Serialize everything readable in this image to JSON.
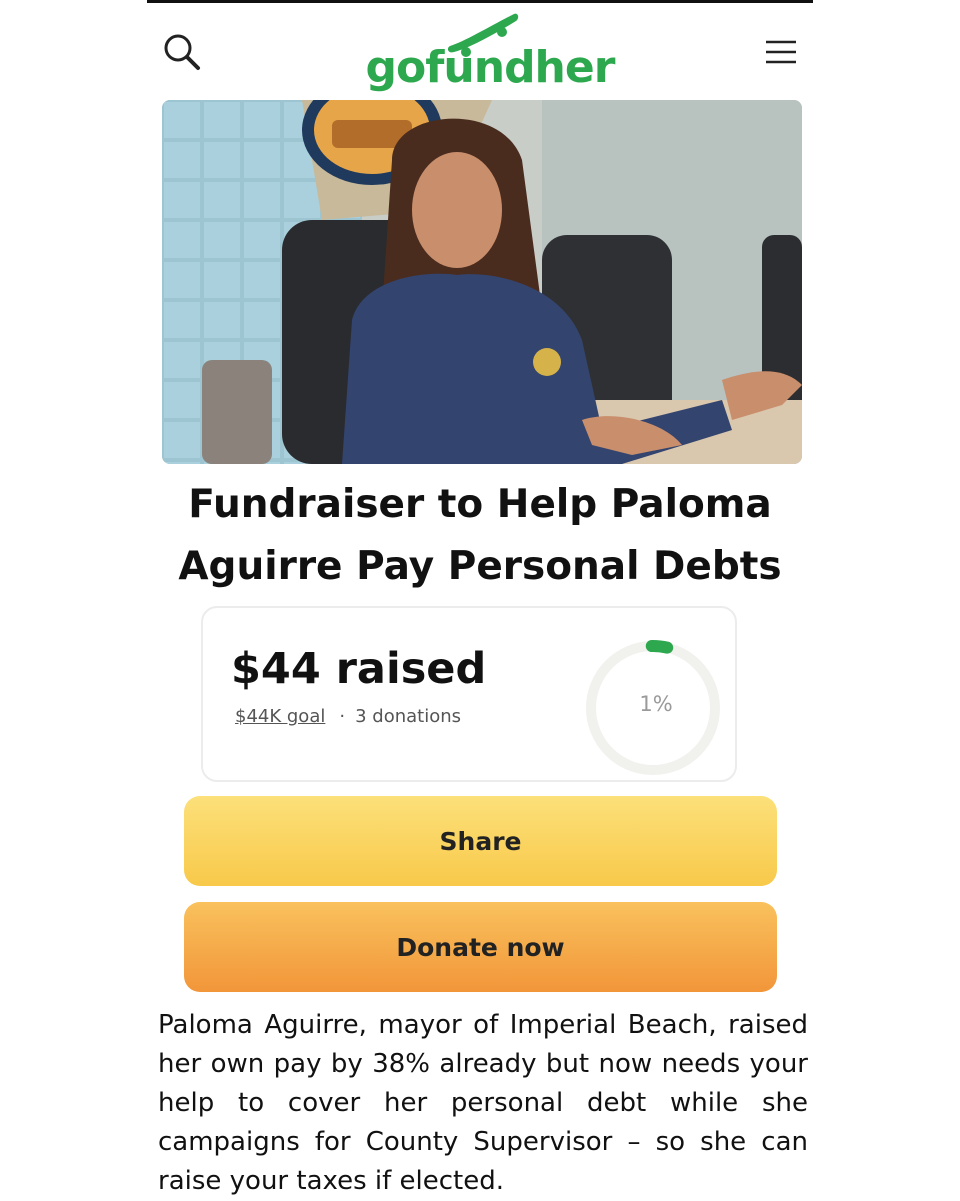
{
  "header": {
    "logo_text": "gofundher",
    "search_icon": "search-icon",
    "menu_icon": "hamburger-menu-icon"
  },
  "campaign": {
    "title": "Fundraiser to Help Paloma Aguirre Pay Personal Debts",
    "raised": "$44 raised",
    "goal": "$44K goal",
    "donations": "3 donations",
    "progress_label": "1%",
    "progress_fraction": 0.01
  },
  "buttons": {
    "share": "Share",
    "donate": "Donate now"
  },
  "description": "Paloma Aguirre, mayor of Imperial Beach, raised her own pay by 38% already but now needs your help to cover her personal debt while she campaigns for County Supervisor – so she can raise your taxes if elected.",
  "colors": {
    "brand_green": "#2ea84f",
    "share_yellow": "#fbd865",
    "donate_orange": "#f4a64a"
  }
}
